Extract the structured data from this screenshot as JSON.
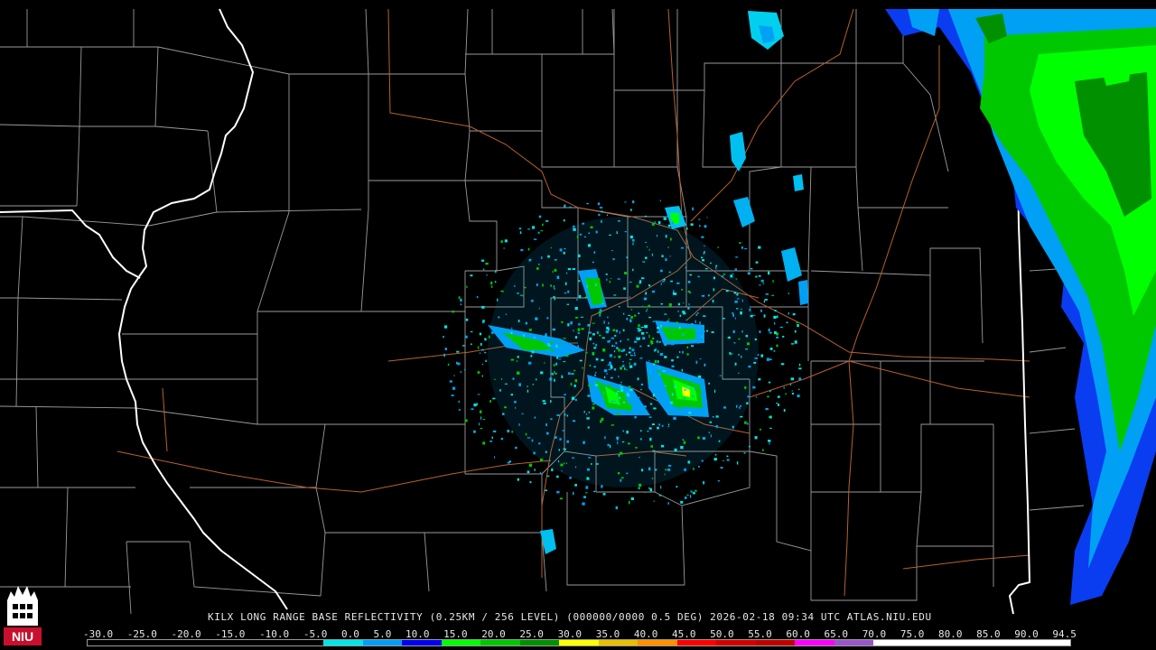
{
  "product": {
    "caption": "KILX LONG RANGE BASE REFLECTIVITY (0.25KM / 256 LEVEL) (000000/0000 0.5 DEG) 2026-02-18 09:34 UTC  ATLAS.NIU.EDU"
  },
  "logo": {
    "text": "NIU",
    "icon": "university-tower-icon",
    "color": "#c8102e"
  },
  "colors": {
    "background": "#000000",
    "county_line": "#9a9a9a",
    "state_line": "#ffffff",
    "highway": "#b8612e"
  },
  "color_scale": {
    "labels": [
      "-30.0",
      "-25.0",
      "-20.0",
      "-15.0",
      "-10.0",
      "-5.0",
      "0.0",
      "5.0",
      "10.0",
      "15.0",
      "20.0",
      "25.0",
      "30.0",
      "35.0",
      "40.0",
      "45.0",
      "50.0",
      "55.0",
      "60.0",
      "65.0",
      "70.0",
      "75.0",
      "80.0",
      "85.0",
      "90.0",
      "94.5"
    ],
    "segments": [
      "#000000",
      "#000000",
      "#000000",
      "#000000",
      "#000000",
      "#000000",
      "#00e5e5",
      "#009ff5",
      "#0000f0",
      "#00ff00",
      "#00c800",
      "#009000",
      "#ffff00",
      "#e8c000",
      "#ff9000",
      "#ff0000",
      "#d40000",
      "#c00000",
      "#ff00ff",
      "#9955c9",
      "#ffffff",
      "#ffffff",
      "#ffffff",
      "#ffffff",
      "#ffffff"
    ]
  }
}
